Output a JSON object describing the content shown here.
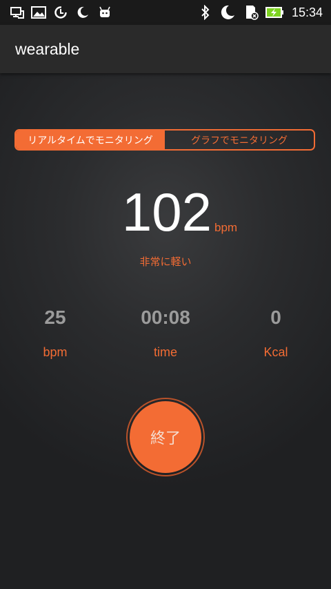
{
  "status_bar": {
    "time": "15:34",
    "icons": [
      "screen-cast-icon",
      "image-icon",
      "data-saver-icon",
      "moon-icon",
      "android-icon",
      "bluetooth-icon",
      "moon-icon",
      "sd-card-icon",
      "battery-charging-icon"
    ]
  },
  "app_bar": {
    "title": "wearable"
  },
  "tabs": {
    "realtime": "リアルタイムでモニタリング",
    "graph": "グラフでモニタリング"
  },
  "heart_rate": {
    "value": "102",
    "unit": "bpm",
    "intensity": "非常に軽い"
  },
  "stats": {
    "bpm": {
      "value": "25",
      "label": "bpm"
    },
    "time": {
      "value": "00:08",
      "label": "time"
    },
    "kcal": {
      "value": "0",
      "label": "Kcal"
    }
  },
  "end_button": {
    "label": "終了"
  },
  "colors": {
    "accent": "#f36c34",
    "background": "#2b2c2e",
    "stat_value": "#9b9b9b"
  }
}
